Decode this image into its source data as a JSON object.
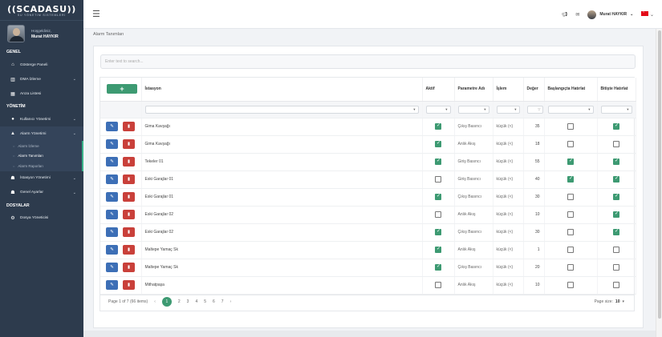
{
  "brand": {
    "name": "SCADASU",
    "tagline": "SU YÖNETİM SİSTEMLERİ"
  },
  "user": {
    "welcome": "Hoşgeldiniz,",
    "name": "Murat HAYKIR"
  },
  "sidebar": {
    "sections": [
      {
        "title": "GENEL",
        "items": [
          {
            "label": "Gösterge Paneli",
            "icon": "home-icon"
          },
          {
            "label": "DMA İzleme",
            "icon": "chart-icon",
            "chevron": true
          },
          {
            "label": "Arıza Listesi",
            "icon": "calendar-icon"
          }
        ]
      },
      {
        "title": "YÖNETİM",
        "items": [
          {
            "label": "Kullanıcı Yönetimi",
            "icon": "user-icon",
            "chevron": true
          },
          {
            "label": "Alarm Yönetimi",
            "icon": "warning-icon",
            "chevron": true,
            "open": true,
            "sub": [
              {
                "label": "Alarm İzleme"
              },
              {
                "label": "Alarm Tanımları",
                "active": true
              },
              {
                "label": "Alarm Raporları"
              }
            ]
          },
          {
            "label": "İstasyon Yönetimi",
            "icon": "sitemap-icon",
            "chevron": true
          },
          {
            "label": "Genel Ayarlar",
            "icon": "sitemap-icon",
            "chevron": true
          }
        ]
      },
      {
        "title": "DOSYALAR",
        "items": [
          {
            "label": "Dosya Yöneticisi",
            "icon": "gear-icon"
          }
        ]
      }
    ]
  },
  "topbar": {
    "username": "Murat HAYKIR"
  },
  "breadcrumb": "Alarm Tanımları",
  "search": {
    "placeholder": "Enter text to search..."
  },
  "grid": {
    "add_label": "+",
    "columns": [
      "İstasyon",
      "Aktif",
      "Parametre Adı",
      "İşlem",
      "Değer",
      "Başlangıçta Hatırlat",
      "Bitişte Hatırlat"
    ],
    "rows": [
      {
        "station": "Gima Kavşağı",
        "active": true,
        "param": "Çıkış Basıncı",
        "op": "küçük (<)",
        "value": "35",
        "start": false,
        "end": true
      },
      {
        "station": "Gima Kavşağı",
        "active": true,
        "param": "Anlık Akış",
        "op": "küçük (<)",
        "value": "18",
        "start": false,
        "end": false
      },
      {
        "station": "Tekeler 01",
        "active": true,
        "param": "Giriş Basıncı",
        "op": "küçük (<)",
        "value": "55",
        "start": true,
        "end": true
      },
      {
        "station": "Eski Garajlar 01",
        "active": false,
        "param": "Giriş Basıncı",
        "op": "küçük (<)",
        "value": "40",
        "start": true,
        "end": true
      },
      {
        "station": "Eski Garajlar 01",
        "active": true,
        "param": "Çıkış Basıncı",
        "op": "küçük (<)",
        "value": "30",
        "start": false,
        "end": true
      },
      {
        "station": "Eski Garajlar 02",
        "active": false,
        "param": "Anlık Akış",
        "op": "küçük (<)",
        "value": "10",
        "start": false,
        "end": true
      },
      {
        "station": "Eski Garajlar 02",
        "active": true,
        "param": "Çıkış Basıncı",
        "op": "küçük (<)",
        "value": "30",
        "start": false,
        "end": true
      },
      {
        "station": "Maltepe Yamaç Sk",
        "active": true,
        "param": "Anlık Akış",
        "op": "küçük (<)",
        "value": "1",
        "start": false,
        "end": false
      },
      {
        "station": "Maltepe Yamaç Sk",
        "active": true,
        "param": "Çıkış Basıncı",
        "op": "küçük (<)",
        "value": "20",
        "start": false,
        "end": false
      },
      {
        "station": "Mithatpaşa",
        "active": false,
        "param": "Anlık Akış",
        "op": "küçük (<)",
        "value": "10",
        "start": false,
        "end": false
      }
    ]
  },
  "pager": {
    "summary": "Page 1 of 7 (66 items)",
    "current": "1",
    "pages": [
      "2",
      "3",
      "4",
      "5",
      "6",
      "7"
    ],
    "size_label": "Page size:",
    "size_value": "10"
  },
  "colors": {
    "sidebar": "#2d3b4d",
    "accent": "#3d9a72",
    "edit": "#3d6fb6",
    "delete": "#c9403a"
  }
}
